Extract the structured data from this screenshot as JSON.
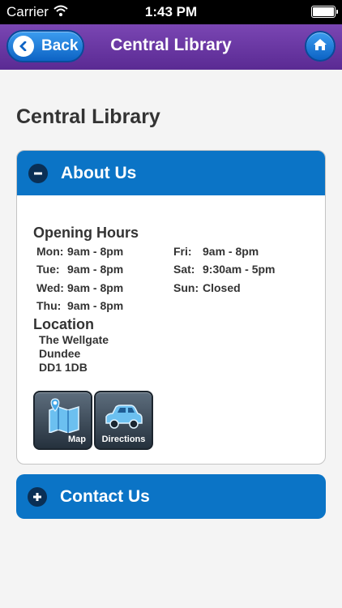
{
  "status_bar": {
    "carrier": "Carrier",
    "time": "1:43 PM"
  },
  "nav": {
    "back_label": "Back",
    "title": "Central Library"
  },
  "page": {
    "title": "Central Library"
  },
  "about": {
    "header": "About Us",
    "hours_heading": "Opening Hours",
    "hours": [
      {
        "day": "Mon:",
        "time": "9am - 8pm"
      },
      {
        "day": "Tue:",
        "time": "9am - 8pm"
      },
      {
        "day": "Wed:",
        "time": "9am - 8pm"
      },
      {
        "day": "Thu:",
        "time": "9am - 8pm"
      },
      {
        "day": "Fri:",
        "time": "9am - 8pm"
      },
      {
        "day": "Sat:",
        "time": "9:30am - 5pm"
      },
      {
        "day": "Sun:",
        "time": "Closed"
      }
    ],
    "location_heading": "Location",
    "address": [
      "The Wellgate",
      "Dundee",
      "DD1 1DB"
    ],
    "map_label": "Map",
    "directions_label": "Directions"
  },
  "contact": {
    "header": "Contact Us"
  },
  "colors": {
    "nav": "#6a37a6",
    "accent": "#0b74c6"
  }
}
